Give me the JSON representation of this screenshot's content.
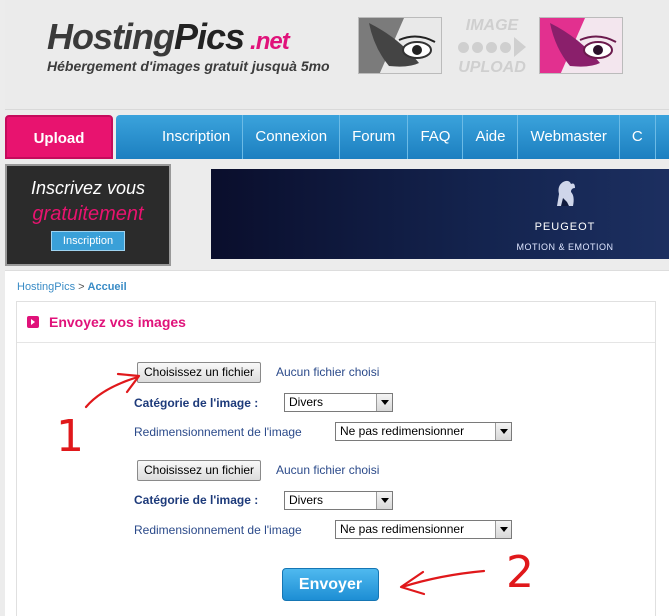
{
  "header": {
    "logo_hosting": "Hosting",
    "logo_pics": "Pics",
    "logo_net": ".net",
    "tagline": "Hébergement d'images gratuit jusquà 5mo",
    "badge_top": "IMAGE",
    "badge_bottom": "UPLOAD"
  },
  "nav": {
    "upload_tab": "Upload",
    "items": [
      {
        "label": "Inscription"
      },
      {
        "label": "Connexion"
      },
      {
        "label": "Forum"
      },
      {
        "label": "FAQ"
      },
      {
        "label": "Aide"
      },
      {
        "label": "Webmaster"
      },
      {
        "label": "C"
      }
    ]
  },
  "promo": {
    "line1": "Inscrivez vous",
    "line2": "gratuitement",
    "button": "Inscription"
  },
  "ad": {
    "brand": "PEUGEOT",
    "slogan": "MOTION & EMOTION"
  },
  "breadcrumb": {
    "root": "HostingPics",
    "sep": ">",
    "current": "Accueil"
  },
  "panel": {
    "title": "Envoyez vos images"
  },
  "uploads": [
    {
      "file_button": "Choisissez un fichier",
      "file_status": "Aucun fichier choisi",
      "category_label": "Catégorie de l'image :",
      "category_value": "Divers",
      "resize_label": "Redimensionnement de l'image",
      "resize_value": "Ne pas redimensionner"
    },
    {
      "file_button": "Choisissez un fichier",
      "file_status": "Aucun fichier choisi",
      "category_label": "Catégorie de l'image :",
      "category_value": "Divers",
      "resize_label": "Redimensionnement de l'image",
      "resize_value": "Ne pas redimensionner"
    }
  ],
  "submit": "Envoyer",
  "annotations": {
    "mark1": "1",
    "mark2": "2",
    "color": "#e0181b"
  },
  "colors": {
    "brand_pink": "#e0127a",
    "nav_blue": "#1c7fc0",
    "submit_blue": "#1d8ed4"
  }
}
